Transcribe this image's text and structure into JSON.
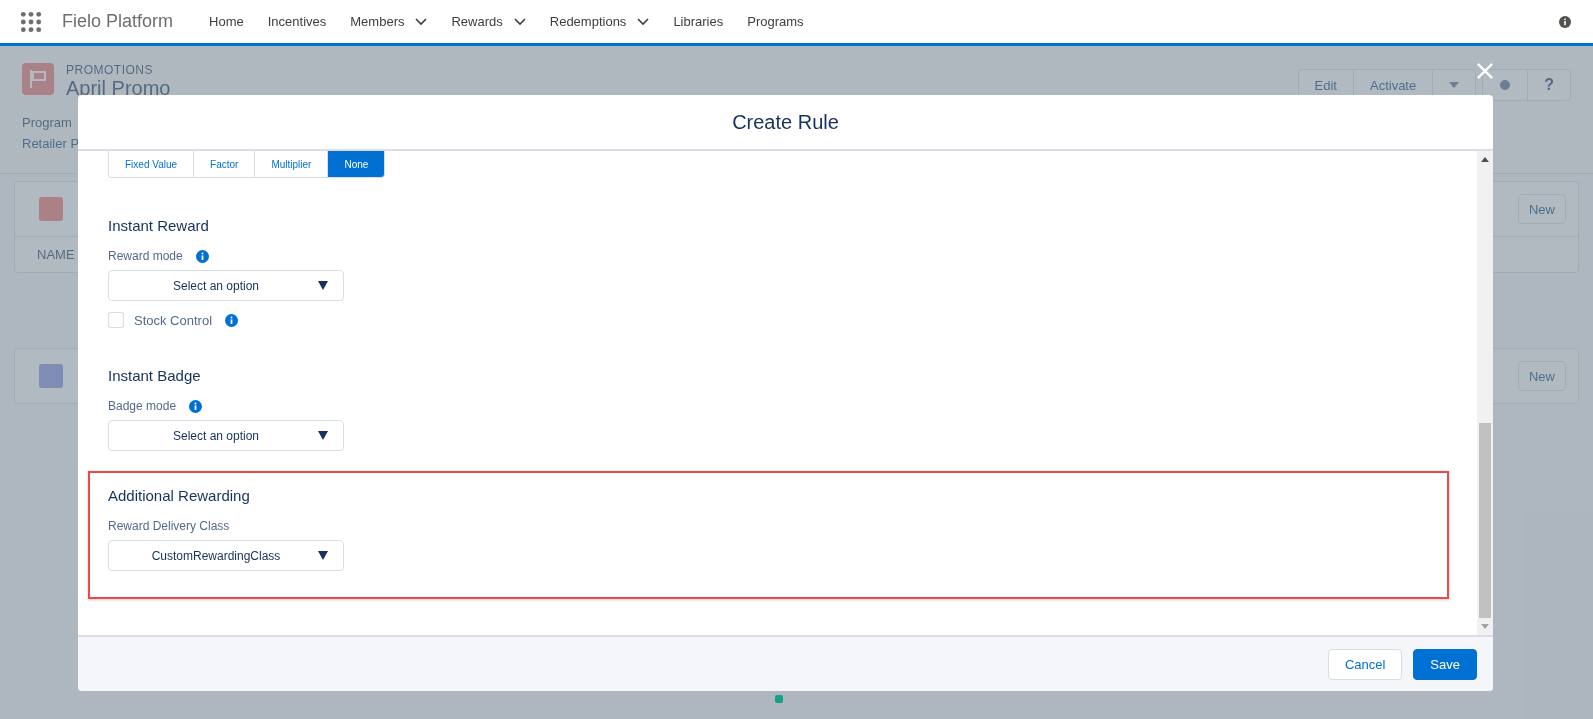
{
  "nav": {
    "app_name": "Fielo Platform",
    "items": [
      {
        "label": "Home",
        "dropdown": false
      },
      {
        "label": "Incentives",
        "dropdown": false
      },
      {
        "label": "Members",
        "dropdown": true
      },
      {
        "label": "Rewards",
        "dropdown": true
      },
      {
        "label": "Redemptions",
        "dropdown": true
      },
      {
        "label": "Libraries",
        "dropdown": false
      },
      {
        "label": "Programs",
        "dropdown": false
      }
    ]
  },
  "background_page": {
    "object_type": "PROMOTIONS",
    "title": "April Promo",
    "actions": [
      "Edit",
      "Activate"
    ],
    "help_label": "?",
    "field_label": "Program",
    "field_value": "Retailer P",
    "related_lists": [
      {
        "column": "NAME",
        "button": "New"
      },
      {
        "button": "New"
      }
    ]
  },
  "modal": {
    "title": "Create Rule",
    "segments": [
      {
        "label": "Fixed Value",
        "selected": false
      },
      {
        "label": "Factor",
        "selected": false
      },
      {
        "label": "Multiplier",
        "selected": false
      },
      {
        "label": "None",
        "selected": true
      }
    ],
    "sections": [
      {
        "heading": "Instant Reward",
        "highlighted": false,
        "fields": [
          {
            "kind": "select",
            "label": "Reward mode",
            "info": true,
            "value": "Select an option"
          },
          {
            "kind": "checkbox",
            "label": "Stock Control",
            "info": true,
            "checked": false
          }
        ]
      },
      {
        "heading": "Instant Badge",
        "highlighted": false,
        "fields": [
          {
            "kind": "select",
            "label": "Badge mode",
            "info": true,
            "value": "Select an option"
          }
        ]
      },
      {
        "heading": "Additional Rewarding",
        "highlighted": true,
        "fields": [
          {
            "kind": "select",
            "label": "Reward Delivery Class",
            "info": false,
            "value": "CustomRewardingClass"
          }
        ]
      }
    ],
    "buttons": [
      {
        "label": "Cancel",
        "kind": "neutral"
      },
      {
        "label": "Save",
        "kind": "brand"
      }
    ]
  }
}
